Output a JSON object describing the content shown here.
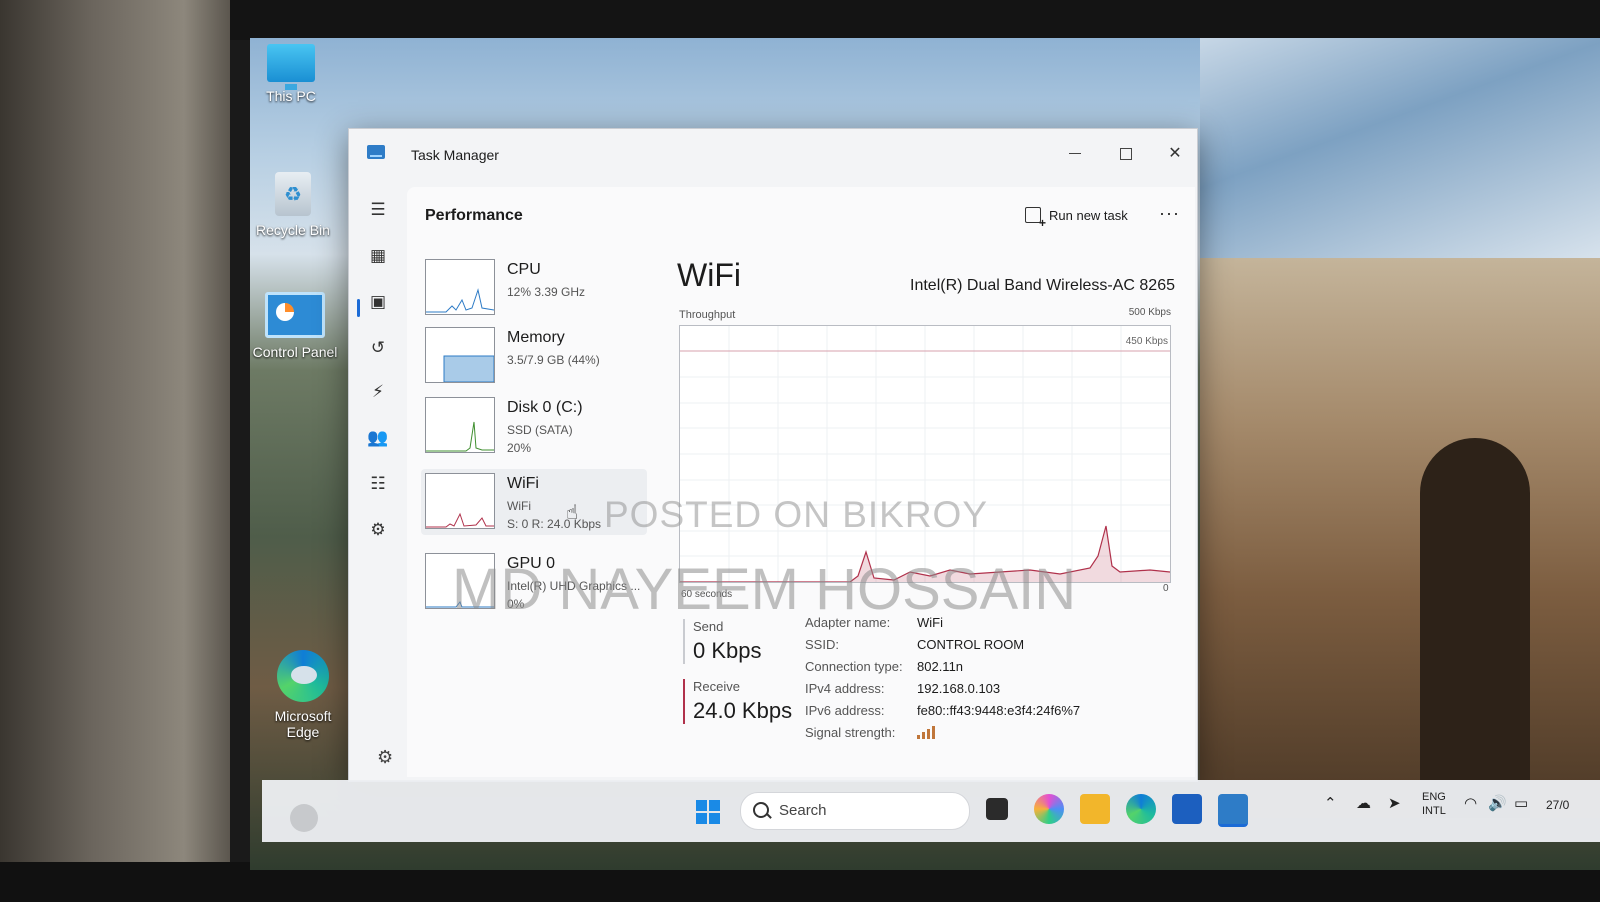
{
  "desktop": {
    "icons": [
      {
        "label": "This PC"
      },
      {
        "label": "Recycle Bin"
      },
      {
        "label": "Control Panel"
      },
      {
        "label": "Microsoft Edge"
      }
    ]
  },
  "window": {
    "title": "Task Manager"
  },
  "header": {
    "page_title": "Performance",
    "run_new_task": "Run new task",
    "more": "···"
  },
  "devices": [
    {
      "name": "CPU",
      "sub": "12%  3.39 GHz",
      "sub2": ""
    },
    {
      "name": "Memory",
      "sub": "3.5/7.9 GB (44%)",
      "sub2": ""
    },
    {
      "name": "Disk 0 (C:)",
      "sub": "SSD (SATA)",
      "sub2": "20%"
    },
    {
      "name": "WiFi",
      "sub": "WiFi",
      "sub2": "S: 0  R: 24.0 Kbps"
    },
    {
      "name": "GPU 0",
      "sub": "Intel(R) UHD Graphics ...",
      "sub2": "0%"
    }
  ],
  "detail": {
    "title": "WiFi",
    "adapter": "Intel(R) Dual Band Wireless-AC 8265",
    "throughput_label": "Throughput",
    "max_label": "500 Kbps",
    "grid_label": "450 Kbps",
    "time_label": "60 seconds",
    "zero_label": "0",
    "send_label": "Send",
    "send_value": "0 Kbps",
    "receive_label": "Receive",
    "receive_value": "24.0 Kbps",
    "properties": [
      {
        "key": "Adapter name:",
        "value": "WiFi"
      },
      {
        "key": "SSID:",
        "value": "CONTROL ROOM"
      },
      {
        "key": "Connection type:",
        "value": "802.11n"
      },
      {
        "key": "IPv4 address:",
        "value": "192.168.0.103"
      },
      {
        "key": "IPv6 address:",
        "value": "fe80::ff43:9448:e3f4:24f6%7"
      },
      {
        "key": "Signal strength:",
        "value": ""
      }
    ],
    "signal_bars": 4
  },
  "watermark": {
    "line1": "POSTED ON BIKROY",
    "line2": "MD NAYEEM HOSSAIN"
  },
  "taskbar": {
    "search_text": "Search",
    "lang_line1": "ENG",
    "lang_line2": "INTL",
    "clock": "27/0"
  },
  "colors": {
    "receive_accent": "#b0314b",
    "nav_accent": "#1b6bd6"
  }
}
